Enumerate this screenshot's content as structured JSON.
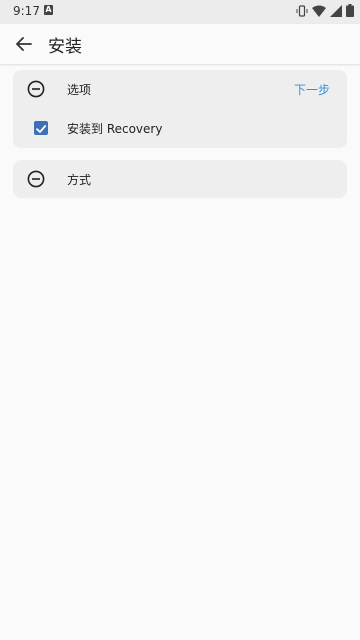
{
  "status_bar": {
    "time": "9:17",
    "notification_badge": "A",
    "icons": [
      "vibrate-icon",
      "wifi-icon",
      "signal-icon",
      "battery-icon"
    ]
  },
  "app_bar": {
    "back_icon": "arrow-left-icon",
    "title": "安装"
  },
  "options_card": {
    "icon": "minus-circle-icon",
    "label": "选项",
    "next_label": "下一步",
    "checkbox_label": "安装到 Recovery",
    "checkbox_checked": true
  },
  "method_card": {
    "icon": "minus-circle-icon",
    "label": "方式"
  },
  "colors": {
    "accent": "#3a8fd8",
    "checkbox": "#3f6fb5",
    "card_bg": "#eeeeee",
    "page_bg": "#fafafa"
  }
}
